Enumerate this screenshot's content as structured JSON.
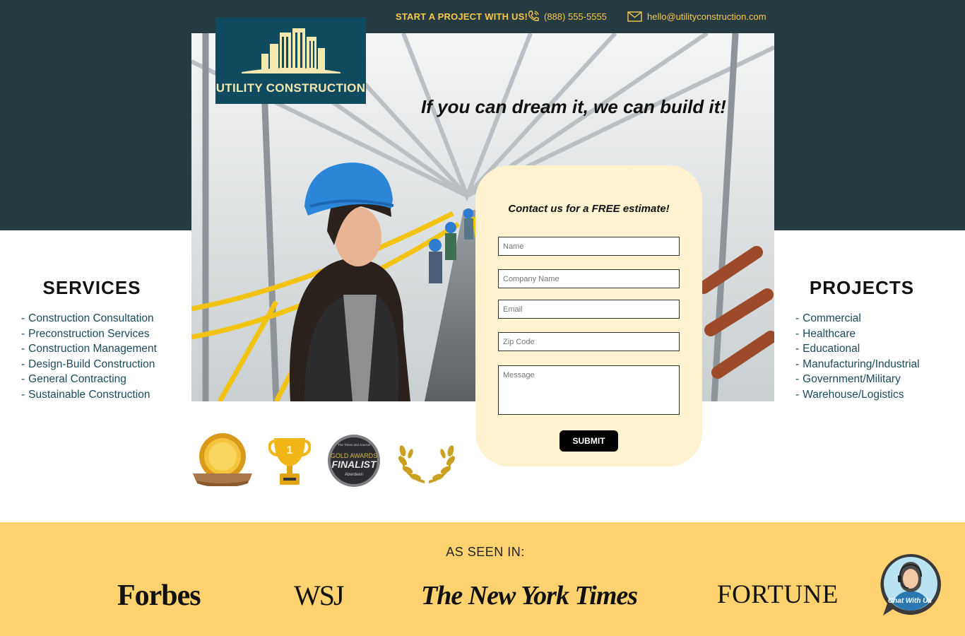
{
  "topbar": {
    "cta": "START A PROJECT WITH US!",
    "phone": "(888) 555-5555",
    "email": "hello@utilityconstruction.com"
  },
  "logo": {
    "text": "UTILITY CONSTRUCTION"
  },
  "hero": {
    "tagline": "If you can dream it, we can build it!"
  },
  "form": {
    "title": "Contact us for a FREE estimate!",
    "fields": {
      "name": "Name",
      "company": "Company Name",
      "email": "Email",
      "zip": "Zip Code",
      "message": "Message"
    },
    "submit": "SUBMIT"
  },
  "services": {
    "heading": "SERVICES",
    "items": [
      "Construction Consultation",
      "Preconstruction Services",
      "Construction Management",
      "Design-Build Construction",
      "General Contracting",
      "Sustainable Construction"
    ]
  },
  "projects": {
    "heading": "PROJECTS",
    "items": [
      "Commercial",
      "Healthcare",
      "Educational",
      "Manufacturing/Industrial",
      "Government/Military",
      "Warehouse/Logistics"
    ]
  },
  "awards": {
    "trophy_number": "1",
    "badge_small": "The Times and Journal",
    "badge_top": "GOLD AWARDS",
    "badge_main": "FINALIST",
    "badge_bottom": "Aberdeen"
  },
  "as_seen_in": {
    "label": "AS SEEN IN:",
    "publications": [
      "Forbes",
      "WSJ",
      "The New York Times",
      "FORTUNE"
    ]
  },
  "chat": {
    "label": "Chat With Us"
  },
  "colors": {
    "dark_band": "#263a42",
    "logo_bg": "#0f4a5e",
    "accent_yellow": "#f5c84b",
    "form_bg": "#fff2cf",
    "press_band": "#ffd270",
    "list_text": "#1d4a58"
  }
}
